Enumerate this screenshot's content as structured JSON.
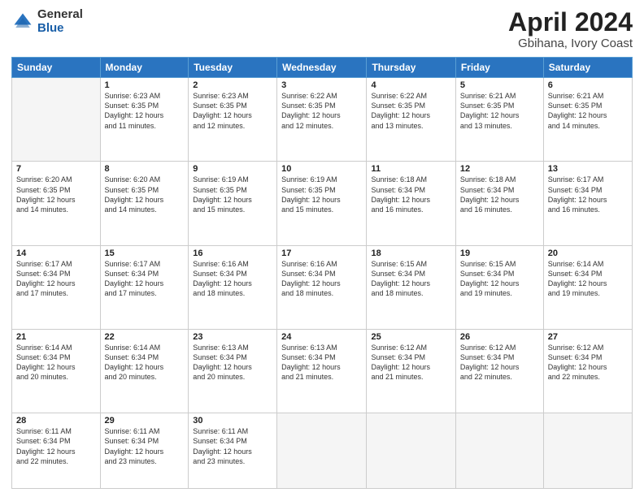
{
  "logo": {
    "general": "General",
    "blue": "Blue"
  },
  "title": "April 2024",
  "subtitle": "Gbihana, Ivory Coast",
  "days_of_week": [
    "Sunday",
    "Monday",
    "Tuesday",
    "Wednesday",
    "Thursday",
    "Friday",
    "Saturday"
  ],
  "weeks": [
    [
      {
        "num": "",
        "info": ""
      },
      {
        "num": "1",
        "info": "Sunrise: 6:23 AM\nSunset: 6:35 PM\nDaylight: 12 hours\nand 11 minutes."
      },
      {
        "num": "2",
        "info": "Sunrise: 6:23 AM\nSunset: 6:35 PM\nDaylight: 12 hours\nand 12 minutes."
      },
      {
        "num": "3",
        "info": "Sunrise: 6:22 AM\nSunset: 6:35 PM\nDaylight: 12 hours\nand 12 minutes."
      },
      {
        "num": "4",
        "info": "Sunrise: 6:22 AM\nSunset: 6:35 PM\nDaylight: 12 hours\nand 13 minutes."
      },
      {
        "num": "5",
        "info": "Sunrise: 6:21 AM\nSunset: 6:35 PM\nDaylight: 12 hours\nand 13 minutes."
      },
      {
        "num": "6",
        "info": "Sunrise: 6:21 AM\nSunset: 6:35 PM\nDaylight: 12 hours\nand 14 minutes."
      }
    ],
    [
      {
        "num": "7",
        "info": "Sunrise: 6:20 AM\nSunset: 6:35 PM\nDaylight: 12 hours\nand 14 minutes."
      },
      {
        "num": "8",
        "info": "Sunrise: 6:20 AM\nSunset: 6:35 PM\nDaylight: 12 hours\nand 14 minutes."
      },
      {
        "num": "9",
        "info": "Sunrise: 6:19 AM\nSunset: 6:35 PM\nDaylight: 12 hours\nand 15 minutes."
      },
      {
        "num": "10",
        "info": "Sunrise: 6:19 AM\nSunset: 6:35 PM\nDaylight: 12 hours\nand 15 minutes."
      },
      {
        "num": "11",
        "info": "Sunrise: 6:18 AM\nSunset: 6:34 PM\nDaylight: 12 hours\nand 16 minutes."
      },
      {
        "num": "12",
        "info": "Sunrise: 6:18 AM\nSunset: 6:34 PM\nDaylight: 12 hours\nand 16 minutes."
      },
      {
        "num": "13",
        "info": "Sunrise: 6:17 AM\nSunset: 6:34 PM\nDaylight: 12 hours\nand 16 minutes."
      }
    ],
    [
      {
        "num": "14",
        "info": "Sunrise: 6:17 AM\nSunset: 6:34 PM\nDaylight: 12 hours\nand 17 minutes."
      },
      {
        "num": "15",
        "info": "Sunrise: 6:17 AM\nSunset: 6:34 PM\nDaylight: 12 hours\nand 17 minutes."
      },
      {
        "num": "16",
        "info": "Sunrise: 6:16 AM\nSunset: 6:34 PM\nDaylight: 12 hours\nand 18 minutes."
      },
      {
        "num": "17",
        "info": "Sunrise: 6:16 AM\nSunset: 6:34 PM\nDaylight: 12 hours\nand 18 minutes."
      },
      {
        "num": "18",
        "info": "Sunrise: 6:15 AM\nSunset: 6:34 PM\nDaylight: 12 hours\nand 18 minutes."
      },
      {
        "num": "19",
        "info": "Sunrise: 6:15 AM\nSunset: 6:34 PM\nDaylight: 12 hours\nand 19 minutes."
      },
      {
        "num": "20",
        "info": "Sunrise: 6:14 AM\nSunset: 6:34 PM\nDaylight: 12 hours\nand 19 minutes."
      }
    ],
    [
      {
        "num": "21",
        "info": "Sunrise: 6:14 AM\nSunset: 6:34 PM\nDaylight: 12 hours\nand 20 minutes."
      },
      {
        "num": "22",
        "info": "Sunrise: 6:14 AM\nSunset: 6:34 PM\nDaylight: 12 hours\nand 20 minutes."
      },
      {
        "num": "23",
        "info": "Sunrise: 6:13 AM\nSunset: 6:34 PM\nDaylight: 12 hours\nand 20 minutes."
      },
      {
        "num": "24",
        "info": "Sunrise: 6:13 AM\nSunset: 6:34 PM\nDaylight: 12 hours\nand 21 minutes."
      },
      {
        "num": "25",
        "info": "Sunrise: 6:12 AM\nSunset: 6:34 PM\nDaylight: 12 hours\nand 21 minutes."
      },
      {
        "num": "26",
        "info": "Sunrise: 6:12 AM\nSunset: 6:34 PM\nDaylight: 12 hours\nand 22 minutes."
      },
      {
        "num": "27",
        "info": "Sunrise: 6:12 AM\nSunset: 6:34 PM\nDaylight: 12 hours\nand 22 minutes."
      }
    ],
    [
      {
        "num": "28",
        "info": "Sunrise: 6:11 AM\nSunset: 6:34 PM\nDaylight: 12 hours\nand 22 minutes."
      },
      {
        "num": "29",
        "info": "Sunrise: 6:11 AM\nSunset: 6:34 PM\nDaylight: 12 hours\nand 23 minutes."
      },
      {
        "num": "30",
        "info": "Sunrise: 6:11 AM\nSunset: 6:34 PM\nDaylight: 12 hours\nand 23 minutes."
      },
      {
        "num": "",
        "info": ""
      },
      {
        "num": "",
        "info": ""
      },
      {
        "num": "",
        "info": ""
      },
      {
        "num": "",
        "info": ""
      }
    ]
  ]
}
